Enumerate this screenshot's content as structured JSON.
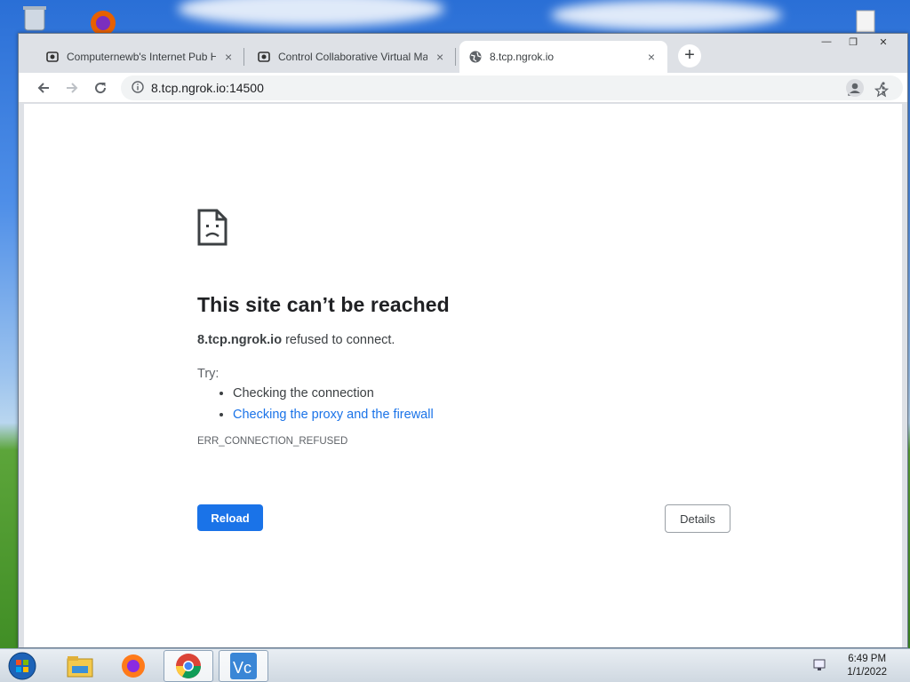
{
  "tabs": [
    {
      "title": "Computernewb's Internet Pub H",
      "close": "×"
    },
    {
      "title": "Control Collaborative Virtual Ma",
      "close": "×"
    },
    {
      "title": "8.tcp.ngrok.io",
      "close": "×"
    }
  ],
  "new_tab_label": "+",
  "window_controls": {
    "minimize": "—",
    "restore": "❐",
    "close": "✕"
  },
  "address": {
    "url": "8.tcp.ngrok.io:14500"
  },
  "error": {
    "title": "This site can’t be reached",
    "host": "8.tcp.ngrok.io",
    "message": " refused to connect.",
    "try_label": "Try:",
    "suggestions": [
      "Checking the connection",
      "Checking the proxy and the firewall"
    ],
    "code": "ERR_CONNECTION_REFUSED",
    "reload_label": "Reload",
    "details_label": "Details"
  },
  "taskbar": {
    "time": "6:49 PM",
    "date": "1/1/2022",
    "items": [
      "file-explorer-icon",
      "firefox-icon",
      "chrome-icon",
      "vnc-viewer-icon"
    ]
  },
  "colors": {
    "accent": "#1a73e8",
    "tab_active": "#ffffff",
    "tabstrip": "#dee1e6"
  }
}
